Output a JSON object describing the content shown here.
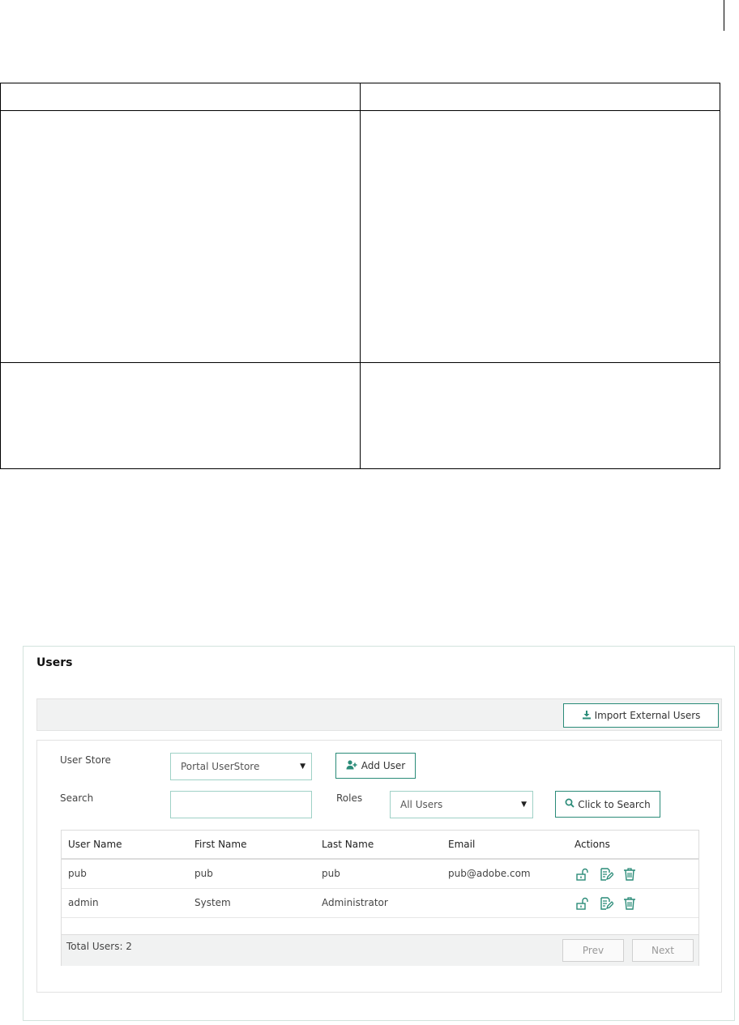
{
  "users_panel": {
    "title": "Users",
    "import_button": "Import External Users",
    "user_store_label": "User Store",
    "user_store_value": "Portal UserStore",
    "add_user_button": "Add User",
    "search_label": "Search",
    "search_value": "",
    "roles_label": "Roles",
    "roles_value": "All Users",
    "search_button": "Click to Search",
    "columns": [
      "User Name",
      "First Name",
      "Last Name",
      "Email",
      "Actions"
    ],
    "rows": [
      {
        "user_name": "pub",
        "first_name": "pub",
        "last_name": "pub",
        "email": "pub@adobe.com"
      },
      {
        "user_name": "admin",
        "first_name": "System",
        "last_name": "Administrator",
        "email": ""
      }
    ],
    "total_users": "Total Users: 2",
    "prev_button": "Prev",
    "next_button": "Next",
    "icons": {
      "import": "download-icon",
      "add_user": "add-user-icon",
      "search": "search-icon",
      "row_actions": [
        "unlock-icon",
        "edit-icon",
        "delete-icon"
      ]
    },
    "accent_color": "#2a8b78"
  }
}
